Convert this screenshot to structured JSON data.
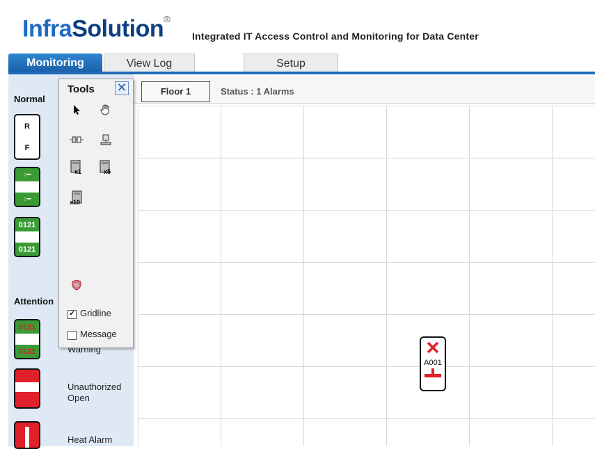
{
  "header": {
    "logo_part1": "Infra",
    "logo_part2": "Solution",
    "logo_mark": "®",
    "tagline": "Integrated IT Access Control and Monitoring for Data Center"
  },
  "tabs": [
    {
      "label": "Monitoring",
      "active": true
    },
    {
      "label": "View Log",
      "active": false
    },
    {
      "label": "Setup",
      "active": false
    }
  ],
  "legend": {
    "normal_heading": "Normal",
    "attention_heading": "Attention",
    "items": [
      {
        "icon": "door-rf-icon",
        "top": "R",
        "bottom": "F",
        "label": ""
      },
      {
        "icon": "door-key-icon",
        "label": ""
      },
      {
        "icon": "door-code-icon",
        "top": "0121",
        "bottom": "0121",
        "label": ""
      },
      {
        "icon": "door-code-warning-icon",
        "top": "0121",
        "bottom": "0121",
        "label": "Warning"
      },
      {
        "icon": "door-unauthorized-icon",
        "label": "Unauthorized Open"
      },
      {
        "icon": "door-heat-icon",
        "label": "Heat Alarm"
      }
    ],
    "unauthorized_label_line1": "Unauthorized",
    "unauthorized_label_line2": "Open",
    "heat_label": "Heat Alarm",
    "warning_label": "Warning"
  },
  "tools": {
    "title": "Tools",
    "close_icon": "close-icon",
    "items": [
      "pointer-icon",
      "pan-hand-icon",
      "connector-icon",
      "device-icon",
      "rack-x1-icon",
      "rack-x5-icon",
      "rack-x10-icon",
      "shield-icon"
    ],
    "x1_label": "x1",
    "x5_label": "x5",
    "x10_label": "x10",
    "gridline_label": "Gridline",
    "gridline_checked": true,
    "message_label": "Message",
    "message_checked": false
  },
  "main": {
    "floor_button": "Floor 1",
    "status_text": "Status : 1 Alarms",
    "alarm_device": {
      "label": "A001",
      "icon": "alarm-x-icon"
    }
  },
  "colors": {
    "accent": "#1e6bb8",
    "legend_bg": "#dfe9f6",
    "normal_green": "#3a9b35",
    "alarm_red": "#e0202a"
  }
}
